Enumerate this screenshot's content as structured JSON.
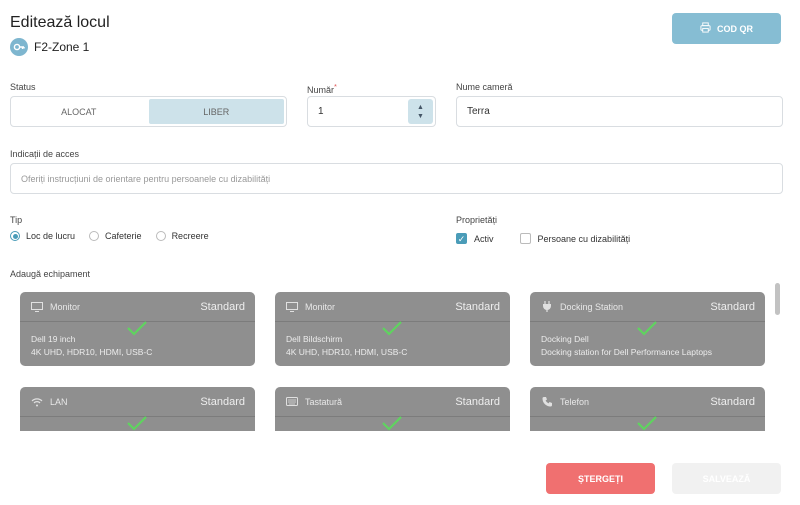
{
  "header": {
    "title": "Editează locul",
    "zone_label": "F2-Zone 1",
    "qr_button": "COD QR"
  },
  "status": {
    "label": "Status",
    "options": [
      "ALOCAT",
      "LIBER"
    ],
    "selected": "LIBER"
  },
  "number": {
    "label": "Număr",
    "required_mark": "*",
    "value": "1"
  },
  "room": {
    "label": "Nume cameră",
    "value": "Terra"
  },
  "access": {
    "label": "Indicații de acces",
    "placeholder": "Oferiți instrucțiuni de orientare pentru persoanele cu dizabilități"
  },
  "type": {
    "label": "Tip",
    "options": [
      "Loc de lucru",
      "Cafeterie",
      "Recreere"
    ],
    "selected": "Loc de lucru"
  },
  "properties": {
    "label": "Proprietăți",
    "items": [
      {
        "label": "Activ",
        "checked": true
      },
      {
        "label": "Persoane cu dizabilități",
        "checked": false
      }
    ]
  },
  "equipment": {
    "label": "Adaugă echipament",
    "cards": [
      {
        "type": "Monitor",
        "icon": "monitor-icon",
        "badge": "Standard",
        "line1": "Dell 19 inch",
        "line2": "4K UHD, HDR10, HDMI, USB-C"
      },
      {
        "type": "Monitor",
        "icon": "monitor-icon",
        "badge": "Standard",
        "line1": "Dell Bildschirm",
        "line2": "4K UHD, HDR10, HDMI, USB-C"
      },
      {
        "type": "Docking Station",
        "icon": "plug-icon",
        "badge": "Standard",
        "line1": "Docking Dell",
        "line2": "Docking station for Dell Performance Laptops"
      },
      {
        "type": "LAN",
        "icon": "wifi-icon",
        "badge": "Standard",
        "line1": "",
        "line2": ""
      },
      {
        "type": "Tastatură",
        "icon": "keyboard-icon",
        "badge": "Standard",
        "line1": "",
        "line2": ""
      },
      {
        "type": "Telefon",
        "icon": "phone-icon",
        "badge": "Standard",
        "line1": "",
        "line2": ""
      }
    ]
  },
  "actions": {
    "delete": "ȘTERGEȚI",
    "save": "SALVEAZĂ"
  },
  "colors": {
    "accent": "#86bdd3",
    "danger": "#f07070",
    "check": "#5fd35f",
    "card": "#8f8f8f"
  }
}
